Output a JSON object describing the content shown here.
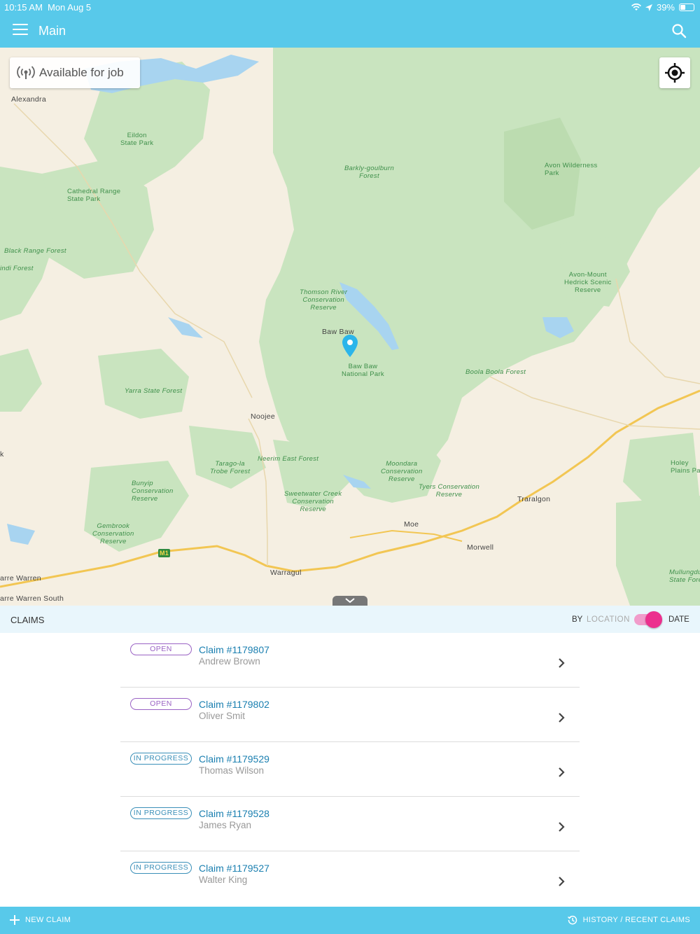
{
  "status_bar": {
    "time": "10:15 AM",
    "date": "Mon Aug 5",
    "battery": "39%"
  },
  "header": {
    "title": "Main"
  },
  "map": {
    "availability_label": "Available for job",
    "labels": {
      "alexandra": "Alexandra",
      "eildon_sp": "Eildon\nState Park",
      "cathedral": "Cathedral Range\nState Park",
      "black_range": "Black Range Forest",
      "indi_forest": "indi Forest",
      "barkly": "Barkly-goulburn\nForest",
      "avon": "Avon Wilderness\nPark",
      "avon_mount": "Avon-Mount\nHedrick Scenic\nReserve",
      "thomson": "Thomson River\nConservation\nReserve",
      "baw_baw": "Baw Baw",
      "baw_baw_np": "Baw Baw\nNational Park",
      "boola": "Boola Boola Forest",
      "yarra": "Yarra State Forest",
      "noojee": "Noojee",
      "tarago": "Tarago-la\nTrobe Forest",
      "neerim": "Neerim East Forest",
      "moondara": "Moondara\nConservation\nReserve",
      "holey": "Holey\nPlains Pa",
      "bunyip": "Bunyip\nConservation\nReserve",
      "sweetwater": "Sweetwater Creek\nConservation\nReserve",
      "tyers": "Tyers Conservation\nReserve",
      "traralgon": "Traralgon",
      "moe": "Moe",
      "morwell": "Morwell",
      "gembrook": "Gembrook\nConservation\nReserve",
      "m1": "M1",
      "warragul": "Warragul",
      "warren": "arre Warren",
      "warren_south": "arre Warren South",
      "mullungdu": "Mullungdu\nState Fore",
      "k": "k"
    }
  },
  "claims_bar": {
    "title": "CLAIMS",
    "by": "BY",
    "location": "LOCATION",
    "date": "DATE"
  },
  "claims": [
    {
      "status": "OPEN",
      "status_type": "open",
      "number": "Claim #1179807",
      "name": "Andrew Brown"
    },
    {
      "status": "OPEN",
      "status_type": "open",
      "number": "Claim #1179802",
      "name": "Oliver Smit"
    },
    {
      "status": "IN PROGRESS",
      "status_type": "progress",
      "number": "Claim #1179529",
      "name": "Thomas Wilson"
    },
    {
      "status": "IN PROGRESS",
      "status_type": "progress",
      "number": "Claim #1179528",
      "name": "James Ryan"
    },
    {
      "status": "IN PROGRESS",
      "status_type": "progress",
      "number": "Claim #1179527",
      "name": "Walter King"
    }
  ],
  "bottom_bar": {
    "new_claim": "NEW CLAIM",
    "history": "HISTORY / RECENT CLAIMS"
  },
  "colors": {
    "accent": "#58c9ea",
    "toggle": "#ec2f8e",
    "open": "#9a62c4",
    "progress": "#3a8fb8"
  }
}
